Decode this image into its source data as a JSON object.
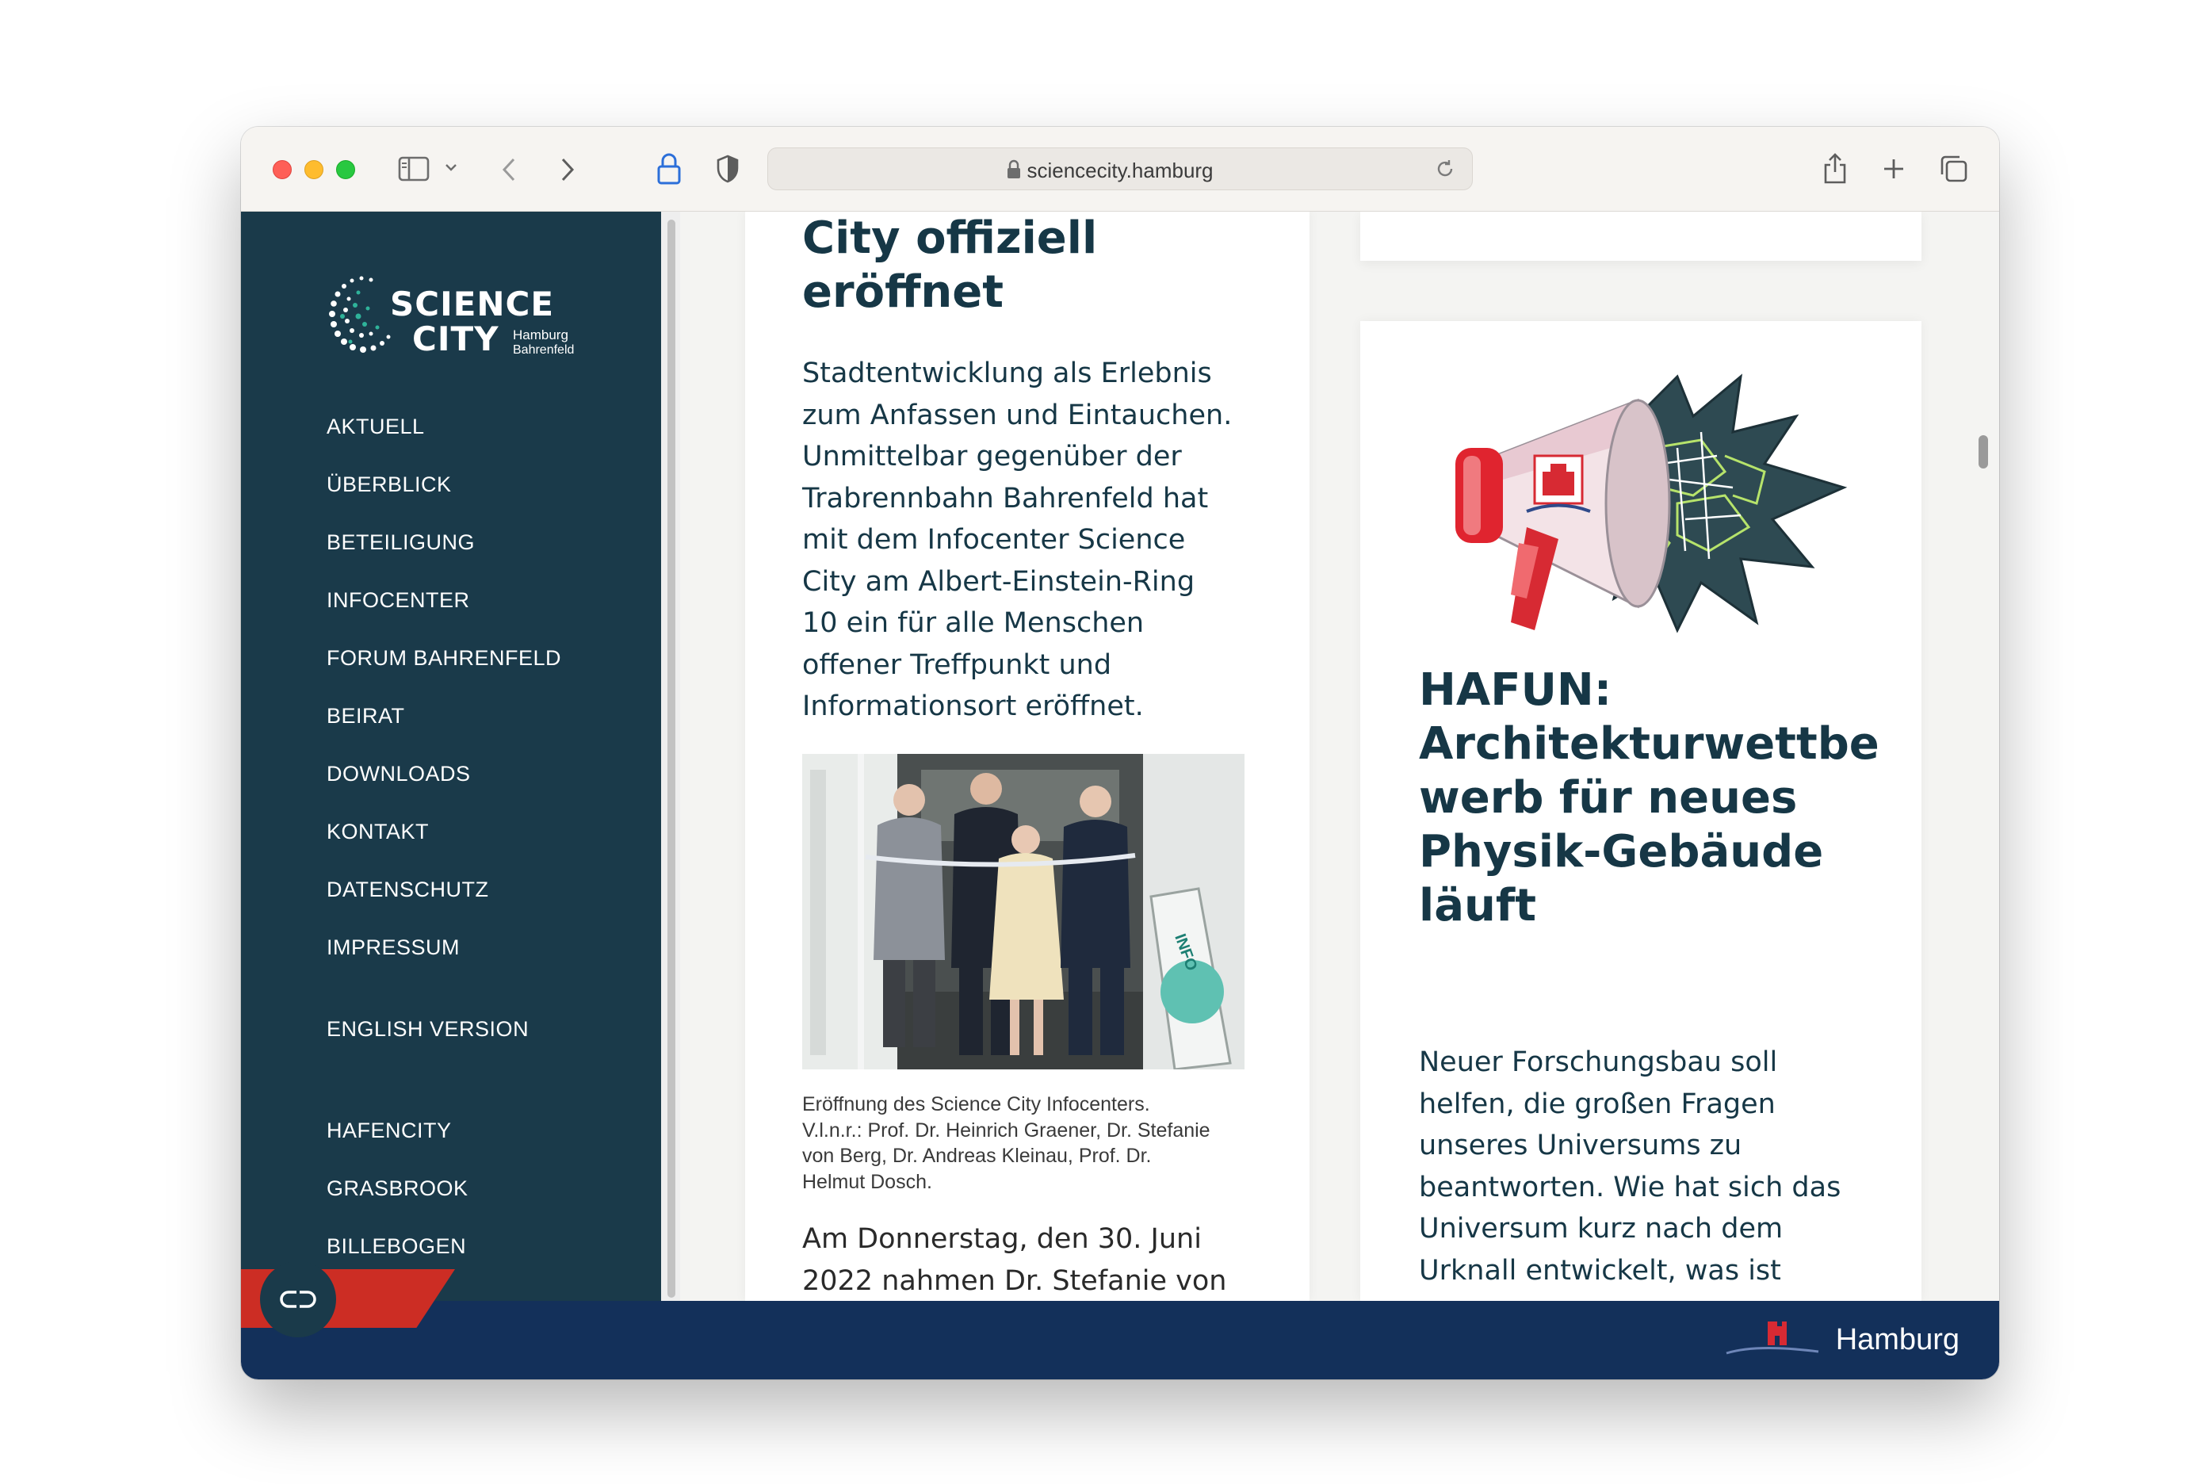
{
  "browser": {
    "url": "sciencecity.hamburg"
  },
  "logo": {
    "line1": "SCIENCE",
    "line2": "CITY",
    "sub1": "Hamburg",
    "sub2": "Bahrenfeld"
  },
  "nav": {
    "items": [
      "AKTUELL",
      "ÜBERBLICK",
      "BETEILIGUNG",
      "INFOCENTER",
      "FORUM BAHRENFELD",
      "BEIRAT",
      "DOWNLOADS",
      "KONTAKT",
      "DATENSCHUTZ",
      "IMPRESSUM",
      "ENGLISH VERSION",
      "HAFENCITY",
      "GRASBROOK",
      "BILLEBOGEN"
    ]
  },
  "article_left": {
    "title_lines": [
      "City offiziell",
      "eröffnet"
    ],
    "intro_lines": [
      "Stadtentwicklung als Erlebnis",
      "zum Anfassen und Eintauchen.",
      "Unmittelbar gegenüber der",
      "Trabrennbahn Bahrenfeld hat",
      "mit dem Infocenter Science",
      "City am Albert-Einstein-Ring",
      "10 ein für alle Menschen",
      "offener Treffpunkt und",
      "Informationsort eröffnet."
    ],
    "caption_lines": [
      "Eröffnung des Science City Infocenters.",
      "V.l.n.r.: Prof. Dr. Heinrich Graener, Dr. Stefanie",
      "von Berg, Dr. Andreas Kleinau, Prof. Dr.",
      "Helmut Dosch."
    ],
    "body_lines": [
      "Am Donnerstag, den 30. Juni",
      "2022 nahmen Dr. Stefanie von"
    ]
  },
  "article_right": {
    "title_lines": [
      "HAFUN:",
      "Architekturwettbe",
      "werb für neues",
      "Physik-Gebäude",
      "läuft"
    ],
    "intro_lines": [
      "Neuer Forschungsbau soll",
      "helfen, die großen Fragen",
      "unseres Universums zu",
      "beantworten. Wie hat sich das",
      "Universum kurz nach dem",
      "Urknall entwickelt, was ist"
    ]
  },
  "footer": {
    "city_label": "Hamburg"
  },
  "colors": {
    "sidebar": "#1a3a4a",
    "heading": "#163746",
    "footer": "#13305a",
    "accent_red": "#cc2d24"
  },
  "icons": {
    "sidebar_toggle": "sidebar-icon",
    "back": "chevron-left-icon",
    "forward": "chevron-right-icon",
    "privacy": "lock-icon",
    "shield": "shield-icon",
    "reload": "reload-icon",
    "share": "share-icon",
    "new_tab": "plus-icon",
    "tabs": "tabs-icon",
    "cookie": "cookie-settings-icon"
  }
}
